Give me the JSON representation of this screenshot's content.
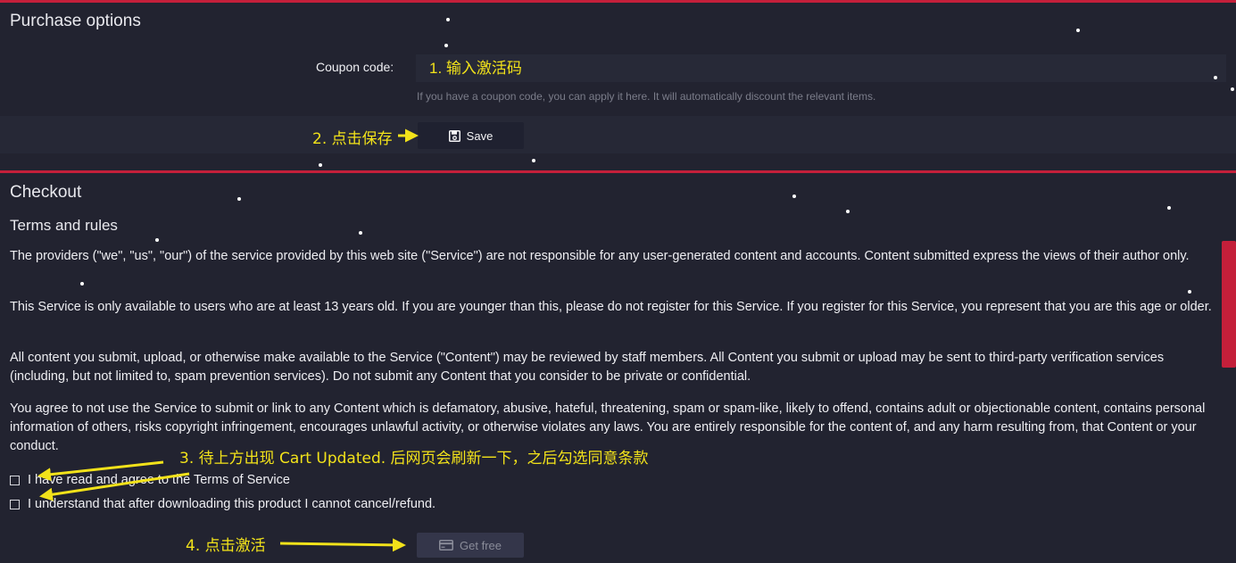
{
  "purchase": {
    "title": "Purchase options",
    "coupon_label": "Coupon code:",
    "coupon_placeholder": "1. 输入激活码",
    "coupon_help": "If you have a coupon code, you can apply it here. It will automatically discount the relevant items.",
    "save_label": "Save",
    "save_icon": "floppy-disk-icon"
  },
  "checkout": {
    "title": "Checkout",
    "terms_heading": "Terms and rules",
    "terms": [
      "The providers (\"we\", \"us\", \"our\") of the service provided by this web site (\"Service\") are not responsible for any user-generated content and accounts. Content submitted express the views of their author only.",
      "This Service is only available to users who are at least 13 years old. If you are younger than this, please do not register for this Service. If you register for this Service, you represent that you are this age or older.",
      "All content you submit, upload, or otherwise make available to the Service (\"Content\") may be reviewed by staff members. All Content you submit or upload may be sent to third-party verification services (including, but not limited to, spam prevention services). Do not submit any Content that you consider to be private or confidential.",
      "You agree to not use the Service to submit or link to any Content which is defamatory, abusive, hateful, threatening, spam or spam-like, likely to offend, contains adult or objectionable content, contains personal information of others, risks copyright infringement, encourages unlawful activity, or otherwise violates any laws. You are entirely responsible for the content of, and any harm resulting from, that Content or your conduct."
    ],
    "checkboxes": [
      {
        "label": "I have read and agree to the Terms of Service",
        "checked": false
      },
      {
        "label": "I understand that after downloading this product I cannot cancel/refund.",
        "checked": false
      }
    ],
    "get_free_label": "Get free",
    "get_free_icon": "credit-card-icon"
  },
  "annotations": {
    "step2": "2. 点击保存",
    "step3": "3. 待上方出现 Cart Updated. 后网页会刷新一下，之后勾选同意条款",
    "step4": "4. 点击激活"
  },
  "colors": {
    "background": "#222330",
    "accent": "#c41f3a",
    "annotation": "#f2e21a",
    "help_text": "#7b7d8a"
  }
}
